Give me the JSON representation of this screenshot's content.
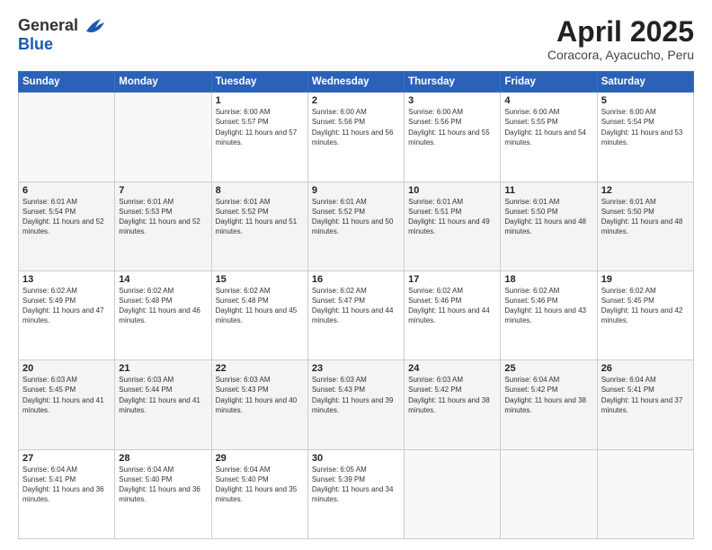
{
  "header": {
    "logo_general": "General",
    "logo_blue": "Blue",
    "month_title": "April 2025",
    "subtitle": "Coracora, Ayacucho, Peru"
  },
  "calendar": {
    "days_of_week": [
      "Sunday",
      "Monday",
      "Tuesday",
      "Wednesday",
      "Thursday",
      "Friday",
      "Saturday"
    ],
    "weeks": [
      [
        {
          "day": "",
          "empty": true
        },
        {
          "day": "",
          "empty": true
        },
        {
          "day": "1",
          "sunrise": "6:00 AM",
          "sunset": "5:57 PM",
          "daylight": "11 hours and 57 minutes."
        },
        {
          "day": "2",
          "sunrise": "6:00 AM",
          "sunset": "5:56 PM",
          "daylight": "11 hours and 56 minutes."
        },
        {
          "day": "3",
          "sunrise": "6:00 AM",
          "sunset": "5:56 PM",
          "daylight": "11 hours and 55 minutes."
        },
        {
          "day": "4",
          "sunrise": "6:00 AM",
          "sunset": "5:55 PM",
          "daylight": "11 hours and 54 minutes."
        },
        {
          "day": "5",
          "sunrise": "6:00 AM",
          "sunset": "5:54 PM",
          "daylight": "11 hours and 53 minutes."
        }
      ],
      [
        {
          "day": "6",
          "sunrise": "6:01 AM",
          "sunset": "5:54 PM",
          "daylight": "11 hours and 52 minutes."
        },
        {
          "day": "7",
          "sunrise": "6:01 AM",
          "sunset": "5:53 PM",
          "daylight": "11 hours and 52 minutes."
        },
        {
          "day": "8",
          "sunrise": "6:01 AM",
          "sunset": "5:52 PM",
          "daylight": "11 hours and 51 minutes."
        },
        {
          "day": "9",
          "sunrise": "6:01 AM",
          "sunset": "5:52 PM",
          "daylight": "11 hours and 50 minutes."
        },
        {
          "day": "10",
          "sunrise": "6:01 AM",
          "sunset": "5:51 PM",
          "daylight": "11 hours and 49 minutes."
        },
        {
          "day": "11",
          "sunrise": "6:01 AM",
          "sunset": "5:50 PM",
          "daylight": "11 hours and 48 minutes."
        },
        {
          "day": "12",
          "sunrise": "6:01 AM",
          "sunset": "5:50 PM",
          "daylight": "11 hours and 48 minutes."
        }
      ],
      [
        {
          "day": "13",
          "sunrise": "6:02 AM",
          "sunset": "5:49 PM",
          "daylight": "11 hours and 47 minutes."
        },
        {
          "day": "14",
          "sunrise": "6:02 AM",
          "sunset": "5:48 PM",
          "daylight": "11 hours and 46 minutes."
        },
        {
          "day": "15",
          "sunrise": "6:02 AM",
          "sunset": "5:48 PM",
          "daylight": "11 hours and 45 minutes."
        },
        {
          "day": "16",
          "sunrise": "6:02 AM",
          "sunset": "5:47 PM",
          "daylight": "11 hours and 44 minutes."
        },
        {
          "day": "17",
          "sunrise": "6:02 AM",
          "sunset": "5:46 PM",
          "daylight": "11 hours and 44 minutes."
        },
        {
          "day": "18",
          "sunrise": "6:02 AM",
          "sunset": "5:46 PM",
          "daylight": "11 hours and 43 minutes."
        },
        {
          "day": "19",
          "sunrise": "6:02 AM",
          "sunset": "5:45 PM",
          "daylight": "11 hours and 42 minutes."
        }
      ],
      [
        {
          "day": "20",
          "sunrise": "6:03 AM",
          "sunset": "5:45 PM",
          "daylight": "11 hours and 41 minutes."
        },
        {
          "day": "21",
          "sunrise": "6:03 AM",
          "sunset": "5:44 PM",
          "daylight": "11 hours and 41 minutes."
        },
        {
          "day": "22",
          "sunrise": "6:03 AM",
          "sunset": "5:43 PM",
          "daylight": "11 hours and 40 minutes."
        },
        {
          "day": "23",
          "sunrise": "6:03 AM",
          "sunset": "5:43 PM",
          "daylight": "11 hours and 39 minutes."
        },
        {
          "day": "24",
          "sunrise": "6:03 AM",
          "sunset": "5:42 PM",
          "daylight": "11 hours and 38 minutes."
        },
        {
          "day": "25",
          "sunrise": "6:04 AM",
          "sunset": "5:42 PM",
          "daylight": "11 hours and 38 minutes."
        },
        {
          "day": "26",
          "sunrise": "6:04 AM",
          "sunset": "5:41 PM",
          "daylight": "11 hours and 37 minutes."
        }
      ],
      [
        {
          "day": "27",
          "sunrise": "6:04 AM",
          "sunset": "5:41 PM",
          "daylight": "11 hours and 36 minutes."
        },
        {
          "day": "28",
          "sunrise": "6:04 AM",
          "sunset": "5:40 PM",
          "daylight": "11 hours and 36 minutes."
        },
        {
          "day": "29",
          "sunrise": "6:04 AM",
          "sunset": "5:40 PM",
          "daylight": "11 hours and 35 minutes."
        },
        {
          "day": "30",
          "sunrise": "6:05 AM",
          "sunset": "5:39 PM",
          "daylight": "11 hours and 34 minutes."
        },
        {
          "day": "",
          "empty": true
        },
        {
          "day": "",
          "empty": true
        },
        {
          "day": "",
          "empty": true
        }
      ]
    ]
  }
}
